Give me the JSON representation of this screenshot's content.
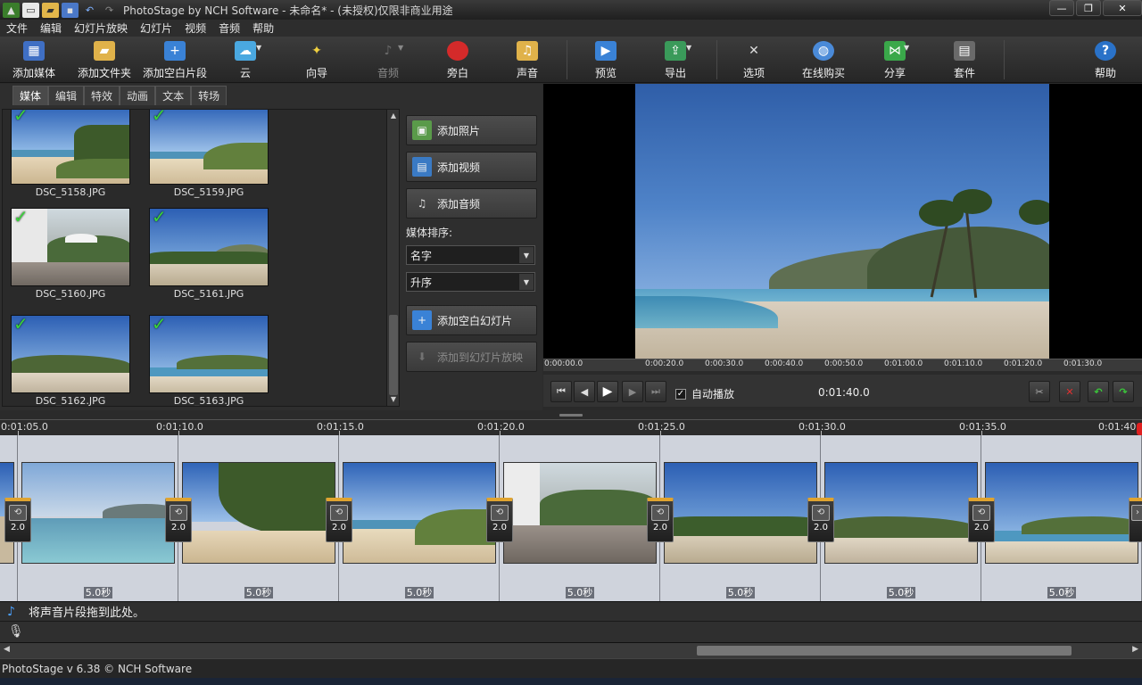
{
  "window": {
    "title": "PhotoStage by NCH Software - 未命名* - (未授权)仅限非商业用途",
    "buttons": [
      "—",
      "❐",
      "✕"
    ]
  },
  "menu": [
    "文件",
    "编辑",
    "幻灯片放映",
    "幻灯片",
    "视频",
    "音频",
    "帮助"
  ],
  "toolbar": {
    "items": [
      {
        "label": "添加媒体",
        "icon": "add-media-icon"
      },
      {
        "label": "添加文件夹",
        "icon": "add-folder-icon"
      },
      {
        "label": "添加空白片段",
        "icon": "add-blank-clip-icon"
      },
      {
        "label": "云",
        "icon": "cloud-icon"
      },
      {
        "label": "向导",
        "icon": "wizard-icon"
      },
      {
        "label": "音频",
        "icon": "audio-icon"
      },
      {
        "label": "旁白",
        "icon": "record-icon"
      },
      {
        "label": "声音",
        "icon": "sound-icon"
      },
      {
        "label": "预览",
        "icon": "preview-icon"
      },
      {
        "label": "导出",
        "icon": "export-icon"
      },
      {
        "label": "选项",
        "icon": "options-icon"
      },
      {
        "label": "在线购买",
        "icon": "buy-online-icon"
      },
      {
        "label": "分享",
        "icon": "share-icon"
      },
      {
        "label": "套件",
        "icon": "suite-icon"
      },
      {
        "label": "帮助",
        "icon": "help-icon"
      }
    ]
  },
  "tabs": [
    "媒体",
    "编辑",
    "特效",
    "动画",
    "文本",
    "转场"
  ],
  "media": [
    {
      "name": "DSC_5158.JPG"
    },
    {
      "name": "DSC_5159.JPG"
    },
    {
      "name": "DSC_5160.JPG"
    },
    {
      "name": "DSC_5161.JPG"
    },
    {
      "name": "DSC_5162.JPG"
    },
    {
      "name": "DSC_5163.JPG"
    }
  ],
  "side": {
    "add_photo": "添加照片",
    "add_video": "添加视频",
    "add_audio": "添加音频",
    "sort_label": "媒体排序:",
    "sort_by": "名字",
    "sort_order": "升序",
    "add_blank_slide": "添加空白幻灯片",
    "add_to_slideshow": "添加到幻灯片放映"
  },
  "preview": {
    "ruler": [
      "0:00:00.0",
      "0:00:20.0",
      "0:00:30.0",
      "0:00:40.0",
      "0:00:50.0",
      "0:01:00.0",
      "0:01:10.0",
      "0:01:20.0",
      "0:01:30.0"
    ],
    "autoplay": "自动播放",
    "timecode": "0:01:40.0"
  },
  "timeline": {
    "ruler": [
      "0:01:05.0",
      "0:01:10.0",
      "0:01:15.0",
      "0:01:20.0",
      "0:01:25.0",
      "0:01:30.0",
      "0:01:35.0",
      "0:01:40.0"
    ],
    "clips": [
      {
        "duration": "5.0秒"
      },
      {
        "duration": "5.0秒"
      },
      {
        "duration": "5.0秒"
      },
      {
        "duration": "5.0秒"
      },
      {
        "duration": "5.0秒"
      },
      {
        "duration": "5.0秒"
      },
      {
        "duration": "5.0秒"
      }
    ],
    "transitions": [
      "2.0",
      "2.0",
      "2.0",
      "2.0",
      "2.0",
      "2.0",
      "2.0"
    ],
    "audio_hint": "将声音片段拖到此处。"
  },
  "status": "PhotoStage v 6.38 © NCH Software"
}
